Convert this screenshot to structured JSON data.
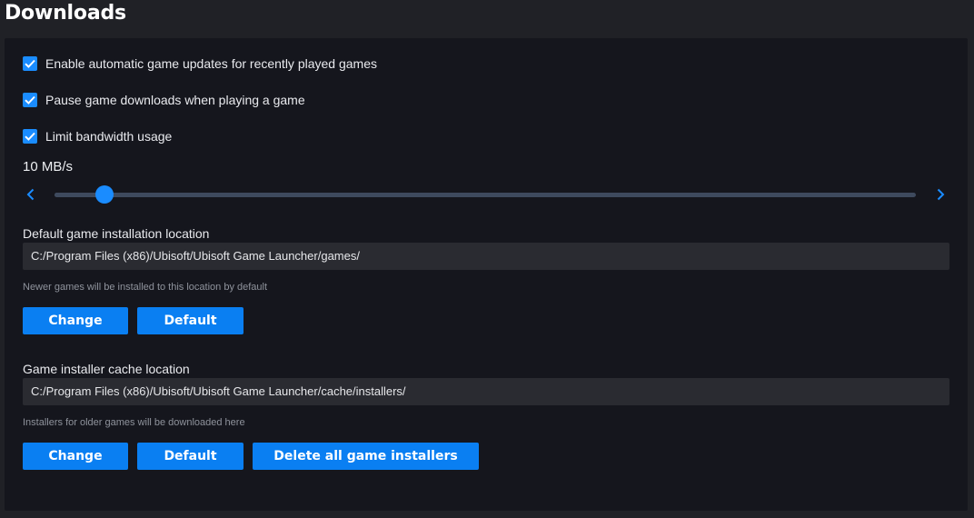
{
  "page": {
    "title": "Downloads"
  },
  "options": {
    "auto_updates": {
      "label": "Enable automatic game updates for recently played games",
      "checked": true
    },
    "pause_downloads": {
      "label": "Pause game downloads when playing a game",
      "checked": true
    },
    "limit_bandwidth": {
      "label": "Limit bandwidth usage",
      "checked": true
    }
  },
  "bandwidth": {
    "value_label": "10 MB/s",
    "slider_fraction": 0.058
  },
  "install_location": {
    "label": "Default game installation location",
    "path": "C:/Program Files (x86)/Ubisoft/Ubisoft Game Launcher/games/",
    "hint": "Newer games will be installed to this location by default",
    "change_label": "Change",
    "default_label": "Default"
  },
  "cache_location": {
    "label": "Game installer cache location",
    "path": "C:/Program Files (x86)/Ubisoft/Ubisoft Game Launcher/cache/installers/",
    "hint": "Installers for older games will be downloaded here",
    "change_label": "Change",
    "default_label": "Default",
    "delete_label": "Delete all game installers"
  },
  "colors": {
    "accent": "#1a8cff",
    "button": "#0a7ff2",
    "panel": "#15161d",
    "background": "#202126",
    "field": "#2a2b31",
    "track": "#3e4a5e"
  },
  "icons": {
    "checkbox": "checkmark-icon",
    "slider_left": "chevron-left-icon",
    "slider_right": "chevron-right-icon"
  }
}
